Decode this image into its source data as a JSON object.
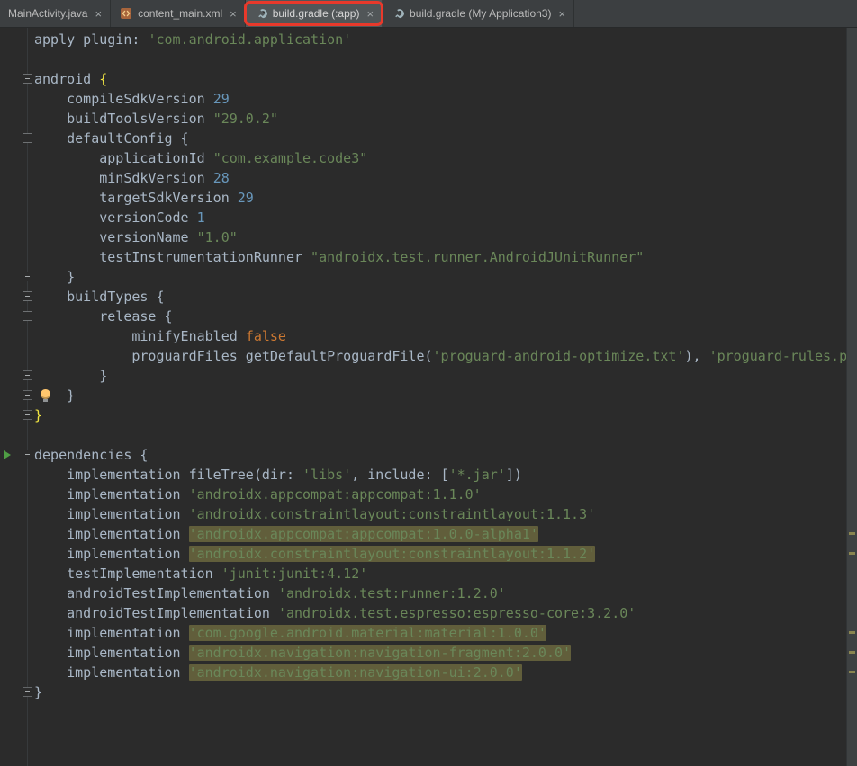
{
  "colors": {
    "bg_editor": "#2b2b2b",
    "bg_tabbar": "#3c3f41",
    "bg_tab_selected": "#515658",
    "text_tab": "#bbbbbb",
    "annotation_red": "#e8392b",
    "tok_default": "#A9B7C6",
    "tok_string": "#6A8759",
    "tok_number": "#6897BB",
    "tok_keyword": "#CC7832",
    "tok_brace_match": "#F0E442",
    "highlight_bg": "#615E3B"
  },
  "tabbar": {
    "tabs": [
      {
        "label": "MainActivity.java",
        "icon": null,
        "selected": false,
        "annotated": false,
        "close_glyph": "×"
      },
      {
        "label": "content_main.xml",
        "icon": "xml-file-icon",
        "selected": false,
        "annotated": false,
        "close_glyph": "×"
      },
      {
        "label": "build.gradle (:app)",
        "icon": "gradle-icon",
        "selected": true,
        "annotated": true,
        "close_glyph": "×"
      },
      {
        "label": "build.gradle (My Application3)",
        "icon": "gradle-icon",
        "selected": false,
        "annotated": false,
        "close_glyph": "×"
      }
    ]
  },
  "editor": {
    "stripe_marks": [
      26,
      27,
      31,
      32,
      33
    ],
    "lines": [
      {
        "gutter": [],
        "tokens": [
          [
            "d",
            "apply plugin: "
          ],
          [
            "s",
            "'com.android.application'"
          ]
        ]
      },
      {
        "gutter": [],
        "tokens": []
      },
      {
        "gutter": [
          "fold-open"
        ],
        "tokens": [
          [
            "d",
            "android "
          ],
          [
            "y",
            "{"
          ]
        ]
      },
      {
        "gutter": [],
        "tokens": [
          [
            "d",
            "    compileSdkVersion "
          ],
          [
            "n",
            "29"
          ]
        ]
      },
      {
        "gutter": [],
        "tokens": [
          [
            "d",
            "    buildToolsVersion "
          ],
          [
            "s",
            "\"29.0.2\""
          ]
        ]
      },
      {
        "gutter": [
          "fold-open"
        ],
        "tokens": [
          [
            "d",
            "    defaultConfig {"
          ]
        ]
      },
      {
        "gutter": [],
        "tokens": [
          [
            "d",
            "        applicationId "
          ],
          [
            "s",
            "\"com.example.code3\""
          ]
        ]
      },
      {
        "gutter": [],
        "tokens": [
          [
            "d",
            "        minSdkVersion "
          ],
          [
            "n",
            "28"
          ]
        ]
      },
      {
        "gutter": [],
        "tokens": [
          [
            "d",
            "        targetSdkVersion "
          ],
          [
            "n",
            "29"
          ]
        ]
      },
      {
        "gutter": [],
        "tokens": [
          [
            "d",
            "        versionCode "
          ],
          [
            "n",
            "1"
          ]
        ]
      },
      {
        "gutter": [],
        "tokens": [
          [
            "d",
            "        versionName "
          ],
          [
            "s",
            "\"1.0\""
          ]
        ]
      },
      {
        "gutter": [],
        "tokens": [
          [
            "d",
            "        testInstrumentationRunner "
          ],
          [
            "s",
            "\"androidx.test.runner.AndroidJUnitRunner\""
          ]
        ]
      },
      {
        "gutter": [
          "fold-end"
        ],
        "tokens": [
          [
            "d",
            "    }"
          ]
        ]
      },
      {
        "gutter": [
          "fold-open"
        ],
        "tokens": [
          [
            "d",
            "    buildTypes {"
          ]
        ]
      },
      {
        "gutter": [
          "fold-open"
        ],
        "tokens": [
          [
            "d",
            "        release {"
          ]
        ]
      },
      {
        "gutter": [],
        "tokens": [
          [
            "d",
            "            minifyEnabled "
          ],
          [
            "k",
            "false"
          ]
        ]
      },
      {
        "gutter": [],
        "tokens": [
          [
            "d",
            "            proguardFiles getDefaultProguardFile("
          ],
          [
            "s",
            "'proguard-android-optimize.txt'"
          ],
          [
            "d",
            "), "
          ],
          [
            "s",
            "'proguard-rules.pro'"
          ]
        ]
      },
      {
        "gutter": [
          "fold-end"
        ],
        "tokens": [
          [
            "d",
            "        }"
          ]
        ]
      },
      {
        "gutter": [
          "fold-end",
          "bulb"
        ],
        "tokens": [
          [
            "d",
            "    }"
          ]
        ]
      },
      {
        "gutter": [
          "fold-end"
        ],
        "tokens": [
          [
            "y",
            "}"
          ]
        ]
      },
      {
        "gutter": [],
        "tokens": []
      },
      {
        "gutter": [
          "run",
          "fold-open"
        ],
        "tokens": [
          [
            "d",
            "dependencies {"
          ]
        ]
      },
      {
        "gutter": [],
        "tokens": [
          [
            "d",
            "    implementation fileTree(dir: "
          ],
          [
            "s",
            "'libs'"
          ],
          [
            "d",
            ", include: ["
          ],
          [
            "s",
            "'*.jar'"
          ],
          [
            "d",
            "])"
          ]
        ]
      },
      {
        "gutter": [],
        "tokens": [
          [
            "d",
            "    implementation "
          ],
          [
            "s",
            "'androidx.appcompat:appcompat:1.1.0'"
          ]
        ]
      },
      {
        "gutter": [],
        "tokens": [
          [
            "d",
            "    implementation "
          ],
          [
            "s",
            "'androidx.constraintlayout:constraintlayout:1.1.3'"
          ]
        ]
      },
      {
        "gutter": [],
        "tokens": [
          [
            "d",
            "    implementation "
          ],
          [
            "hs",
            "'androidx.appcompat:appcompat:1.0.0-alpha1'"
          ]
        ]
      },
      {
        "gutter": [],
        "tokens": [
          [
            "d",
            "    implementation "
          ],
          [
            "hs",
            "'androidx.constraintlayout:constraintlayout:1.1.2'"
          ]
        ]
      },
      {
        "gutter": [],
        "tokens": [
          [
            "d",
            "    testImplementation "
          ],
          [
            "s",
            "'junit:junit:4.12'"
          ]
        ]
      },
      {
        "gutter": [],
        "tokens": [
          [
            "d",
            "    androidTestImplementation "
          ],
          [
            "s",
            "'androidx.test:runner:1.2.0'"
          ]
        ]
      },
      {
        "gutter": [],
        "tokens": [
          [
            "d",
            "    androidTestImplementation "
          ],
          [
            "s",
            "'androidx.test.espresso:espresso-core:3.2.0'"
          ]
        ]
      },
      {
        "gutter": [],
        "tokens": [
          [
            "d",
            "    implementation "
          ],
          [
            "hs",
            "'com.google.android.material:material:1.0.0'"
          ]
        ]
      },
      {
        "gutter": [],
        "tokens": [
          [
            "d",
            "    implementation "
          ],
          [
            "hs",
            "'androidx.navigation:navigation-fragment:2.0.0'"
          ]
        ]
      },
      {
        "gutter": [],
        "tokens": [
          [
            "d",
            "    implementation "
          ],
          [
            "hs",
            "'androidx.navigation:navigation-ui:2.0.0'"
          ]
        ]
      },
      {
        "gutter": [
          "fold-end"
        ],
        "tokens": [
          [
            "d",
            "}"
          ]
        ]
      }
    ]
  }
}
